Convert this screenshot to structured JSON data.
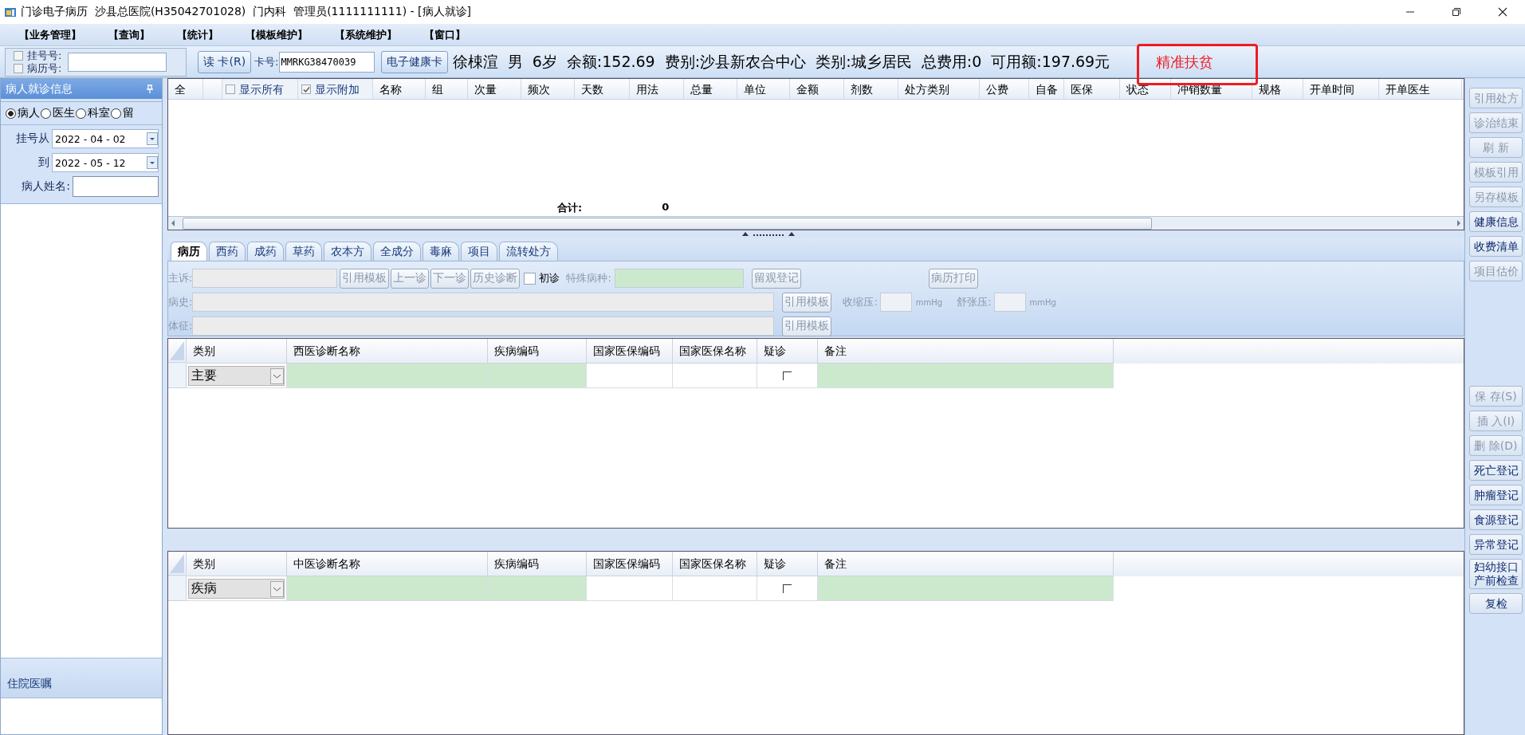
{
  "window": {
    "title": "门诊电子病历  沙县总医院(H35042701028)  门内科  管理员(1111111111) - [病人就诊]"
  },
  "menu": [
    "【业务管理】",
    "【查询】",
    "【统计】",
    "【模板维护】",
    "【系统维护】",
    "【窗口】"
  ],
  "toolbar": {
    "lookup_options": [
      {
        "label": "挂号号:",
        "checked": false
      },
      {
        "label": "病历号:",
        "checked": false
      }
    ],
    "read_card_button": "读 卡(R)",
    "card_label": "卡号:",
    "card_value": "MMRKG38470039",
    "health_card_button": "电子健康卡",
    "patient_info": "徐梀渲  男  6岁  余额:152.69  费别:沙县新农合中心  类别:城乡居民  总费用:0  可用额:197.69元",
    "poverty_tag": "精准扶贫"
  },
  "left_panel": {
    "title": "病人就诊信息",
    "modes": [
      {
        "label": "病人",
        "selected": true
      },
      {
        "label": "医生",
        "selected": false
      },
      {
        "label": "科室",
        "selected": false
      },
      {
        "label": "留",
        "selected": false
      }
    ],
    "date_from": {
      "label": "挂号从",
      "value": "2022 - 04 - 02"
    },
    "date_to": {
      "label": "到",
      "value": "2022 - 05 - 12"
    },
    "name_label": "病人姓名:",
    "bottom_title": "住院医嘱"
  },
  "prescription_table": {
    "columns": [
      {
        "kind": "text",
        "label": "全"
      },
      {
        "kind": "blank"
      },
      {
        "kind": "checkbox",
        "label": "显示所有",
        "checked": false
      },
      {
        "kind": "checkbox",
        "label": "显示附加",
        "checked": true
      },
      {
        "kind": "text",
        "label": "名称"
      },
      {
        "kind": "text",
        "label": "组"
      },
      {
        "kind": "text",
        "label": "次量"
      },
      {
        "kind": "text",
        "label": "频次"
      },
      {
        "kind": "text",
        "label": "天数"
      },
      {
        "kind": "text",
        "label": "用法"
      },
      {
        "kind": "text",
        "label": "总量"
      },
      {
        "kind": "text",
        "label": "单位"
      },
      {
        "kind": "text",
        "label": "金额"
      },
      {
        "kind": "text",
        "label": "剂数"
      },
      {
        "kind": "text",
        "label": "处方类别"
      },
      {
        "kind": "text",
        "label": "公费"
      },
      {
        "kind": "text",
        "label": "自备"
      },
      {
        "kind": "text",
        "label": "医保"
      },
      {
        "kind": "text",
        "label": "状态"
      },
      {
        "kind": "text",
        "label": "冲销数量"
      },
      {
        "kind": "text",
        "label": "规格"
      },
      {
        "kind": "text",
        "label": "开单时间"
      },
      {
        "kind": "text",
        "label": "开单医生"
      }
    ],
    "total_label": "合计:",
    "total_value": "0"
  },
  "tabs": [
    {
      "label": "病历",
      "selected": true
    },
    {
      "label": "西药",
      "selected": false
    },
    {
      "label": "成药",
      "selected": false
    },
    {
      "label": "草药",
      "selected": false
    },
    {
      "label": "农本方",
      "selected": false
    },
    {
      "label": "全成分",
      "selected": false
    },
    {
      "label": "毒麻",
      "selected": false
    },
    {
      "label": "项目",
      "selected": false
    },
    {
      "label": "流转处方",
      "selected": false
    }
  ],
  "record_form": {
    "complaint_label": "主诉:",
    "history_label": "病史:",
    "signs_label": "体征:",
    "complaint_buttons": [
      {
        "label": "引用模板",
        "disabled": true
      },
      {
        "label": "上一诊",
        "disabled": true
      },
      {
        "label": "下一诊",
        "disabled": true
      },
      {
        "label": "历史诊断",
        "disabled": true
      }
    ],
    "first_visit": {
      "label": "初诊",
      "checked": false
    },
    "special_label": "特殊病种:",
    "observation_button": {
      "label": "留观登记",
      "disabled": true
    },
    "print_button": {
      "label": "病历打印",
      "disabled": true
    },
    "history_template_button": {
      "label": "引用模板",
      "disabled": true
    },
    "signs_template_button": {
      "label": "引用模板",
      "disabled": true
    },
    "systolic_label": "收缩压:",
    "systolic_unit": "mmHg",
    "diastolic_label": "舒张压:",
    "diastolic_unit": "mmHg"
  },
  "diagnosis_tables": [
    {
      "columns": [
        {
          "kind": "select",
          "label": "类别"
        },
        {
          "kind": "input",
          "label": "西医诊断名称"
        },
        {
          "kind": "input",
          "label": "疾病编码"
        },
        {
          "kind": "plain",
          "label": "国家医保编码"
        },
        {
          "kind": "plain",
          "label": "国家医保名称"
        },
        {
          "kind": "check",
          "label": "疑诊"
        },
        {
          "kind": "input",
          "label": "备注"
        }
      ],
      "rows": [
        {
          "category": "主要",
          "suspected": false
        }
      ]
    },
    {
      "columns": [
        {
          "kind": "select",
          "label": "类别"
        },
        {
          "kind": "input",
          "label": "中医诊断名称"
        },
        {
          "kind": "input",
          "label": "疾病编码"
        },
        {
          "kind": "plain",
          "label": "国家医保编码"
        },
        {
          "kind": "plain",
          "label": "国家医保名称"
        },
        {
          "kind": "check",
          "label": "疑诊"
        },
        {
          "kind": "input",
          "label": "备注"
        }
      ],
      "rows": [
        {
          "category": "疾病",
          "suspected": false
        }
      ]
    }
  ],
  "side_buttons": {
    "top": [
      {
        "label": "引用处方",
        "disabled": true
      },
      {
        "label": "诊治结束",
        "disabled": true
      },
      {
        "label": "刷 新",
        "disabled": true
      },
      {
        "label": "模板引用",
        "disabled": true
      },
      {
        "label": "另存模板",
        "disabled": true
      },
      {
        "label": "健康信息",
        "disabled": false
      },
      {
        "label": "收费清单",
        "disabled": false
      },
      {
        "label": "项目估价",
        "disabled": true
      }
    ],
    "bottom": [
      {
        "label": "保 存(S)",
        "disabled": true
      },
      {
        "label": "插 入(I)",
        "disabled": true
      },
      {
        "label": "删 除(D)",
        "disabled": true
      },
      {
        "label": "死亡登记",
        "disabled": false
      },
      {
        "label": "肿瘤登记",
        "disabled": false
      },
      {
        "label": "食源登记",
        "disabled": false
      },
      {
        "label": "异常登记",
        "disabled": false
      },
      {
        "label": "妇幼接口产前检查",
        "disabled": false
      },
      {
        "label": "复检",
        "disabled": false
      }
    ]
  }
}
